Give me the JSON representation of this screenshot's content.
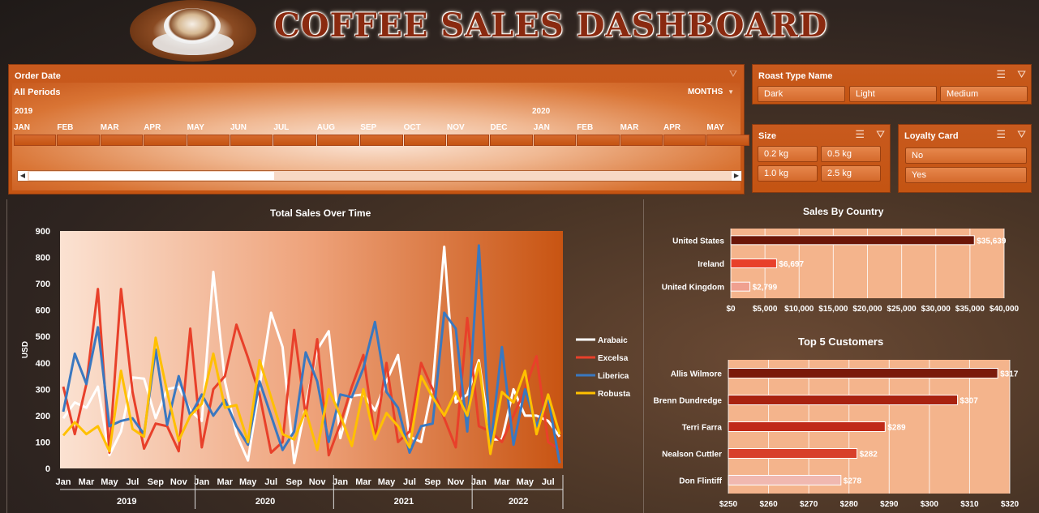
{
  "header": {
    "title": "COFFEE SALES DASHBOARD"
  },
  "timeline": {
    "title": "Order Date",
    "periods_label": "All Periods",
    "unit_label": "MONTHS",
    "years": [
      "2019",
      "2020"
    ],
    "months": [
      "JAN",
      "FEB",
      "MAR",
      "APR",
      "MAY",
      "JUN",
      "JUL",
      "AUG",
      "SEP",
      "OCT",
      "NOV",
      "DEC",
      "JAN",
      "FEB",
      "MAR",
      "APR",
      "MAY"
    ],
    "selection": {
      "from": "JAN 2019",
      "to": "JUN 2019"
    }
  },
  "roast_slicer": {
    "title": "Roast Type Name",
    "items": [
      "Dark",
      "Light",
      "Medium"
    ]
  },
  "size_slicer": {
    "title": "Size",
    "items": [
      "0.2 kg",
      "0.5 kg",
      "1.0 kg",
      "2.5 kg"
    ]
  },
  "loyalty_slicer": {
    "title": "Loyalty Card",
    "items": [
      "No",
      "Yes"
    ]
  },
  "icons": {
    "multiselect": "multi-select-icon",
    "clear_filter": "clear-filter-icon",
    "dropdown": "chevron-down-icon"
  },
  "colors": {
    "panel": "#c85a1e",
    "title": "#8a2a10",
    "arabica": "#ffffff",
    "excelsa": "#e8402a",
    "liberica": "#3a78c0",
    "robusta": "#ffc000"
  },
  "chart_data": [
    {
      "type": "line",
      "title": "Total Sales Over Time",
      "ylabel": "USD",
      "ylim": [
        0,
        900
      ],
      "yticks": [
        0,
        100,
        200,
        300,
        400,
        500,
        600,
        700,
        800,
        900
      ],
      "month_ticks": [
        "Jan",
        "Mar",
        "May",
        "Jul",
        "Sep",
        "Nov",
        "Jan",
        "Mar",
        "May",
        "Jul",
        "Sep",
        "Nov",
        "Jan",
        "Mar",
        "May",
        "Jul",
        "Sep",
        "Nov",
        "Jan",
        "Mar",
        "May",
        "Jul"
      ],
      "years": [
        "2019",
        "2020",
        "2021",
        "2022"
      ],
      "x_months": 44,
      "series": [
        {
          "name": "Arabaic",
          "color": "#ffffff",
          "values": [
            190,
            250,
            230,
            310,
            50,
            140,
            345,
            340,
            190,
            300,
            310,
            220,
            180,
            745,
            330,
            130,
            30,
            310,
            590,
            460,
            20,
            240,
            450,
            520,
            115,
            275,
            280,
            220,
            330,
            430,
            120,
            100,
            310,
            840,
            250,
            280,
            410,
            110,
            110,
            300,
            200,
            200,
            180,
            120
          ]
        },
        {
          "name": "Excelsa",
          "color": "#e8402a",
          "values": [
            310,
            130,
            320,
            680,
            60,
            680,
            290,
            75,
            170,
            160,
            65,
            530,
            80,
            300,
            350,
            545,
            420,
            280,
            60,
            100,
            525,
            200,
            490,
            50,
            170,
            310,
            430,
            115,
            400,
            100,
            140,
            400,
            300,
            190,
            80,
            570,
            160,
            140,
            100,
            200,
            300,
            425,
            100,
            70
          ]
        },
        {
          "name": "Liberica",
          "color": "#3a78c0",
          "values": [
            215,
            435,
            320,
            535,
            160,
            180,
            190,
            130,
            450,
            165,
            350,
            200,
            280,
            200,
            260,
            160,
            90,
            330,
            200,
            70,
            140,
            440,
            330,
            100,
            280,
            270,
            380,
            555,
            290,
            230,
            60,
            160,
            170,
            590,
            530,
            140,
            845,
            80,
            460,
            90,
            300,
            160,
            270,
            20
          ]
        },
        {
          "name": "Robusta",
          "color": "#ffc000",
          "values": [
            125,
            175,
            130,
            160,
            65,
            370,
            150,
            120,
            495,
            290,
            105,
            200,
            245,
            435,
            230,
            240,
            100,
            410,
            270,
            130,
            110,
            220,
            70,
            300,
            200,
            85,
            300,
            110,
            210,
            160,
            80,
            350,
            270,
            200,
            290,
            200,
            400,
            55,
            290,
            250,
            370,
            130,
            280,
            130
          ]
        }
      ]
    },
    {
      "type": "bar",
      "orientation": "horizontal",
      "title": "Sales By Country",
      "categories": [
        "United States",
        "Ireland",
        "United Kingdom"
      ],
      "values": [
        35639,
        6697,
        2799
      ],
      "labels": [
        "$35,639",
        "$6,697",
        "$2,799"
      ],
      "colors": [
        "#6b1608",
        "#e8402a",
        "#f0a090"
      ],
      "xlim": [
        0,
        40000
      ],
      "xticks": [
        "$0",
        "$5,000",
        "$10,000",
        "$15,000",
        "$20,000",
        "$25,000",
        "$30,000",
        "$35,000",
        "$40,000"
      ]
    },
    {
      "type": "bar",
      "orientation": "horizontal",
      "title": "Top 5 Customers",
      "categories": [
        "Allis Wilmore",
        "Brenn Dundredge",
        "Terri Farra",
        "Nealson Cuttler",
        "Don Flintiff"
      ],
      "values": [
        317,
        307,
        289,
        282,
        278
      ],
      "labels": [
        "$317",
        "$307",
        "$289",
        "$282",
        "$278"
      ],
      "colors": [
        "#7a1a0a",
        "#a82210",
        "#c02a18",
        "#d8402a",
        "#f0b8b0"
      ],
      "xlim": [
        250,
        320
      ],
      "xticks": [
        "$250",
        "$260",
        "$270",
        "$280",
        "$290",
        "$300",
        "$310",
        "$320"
      ]
    }
  ]
}
